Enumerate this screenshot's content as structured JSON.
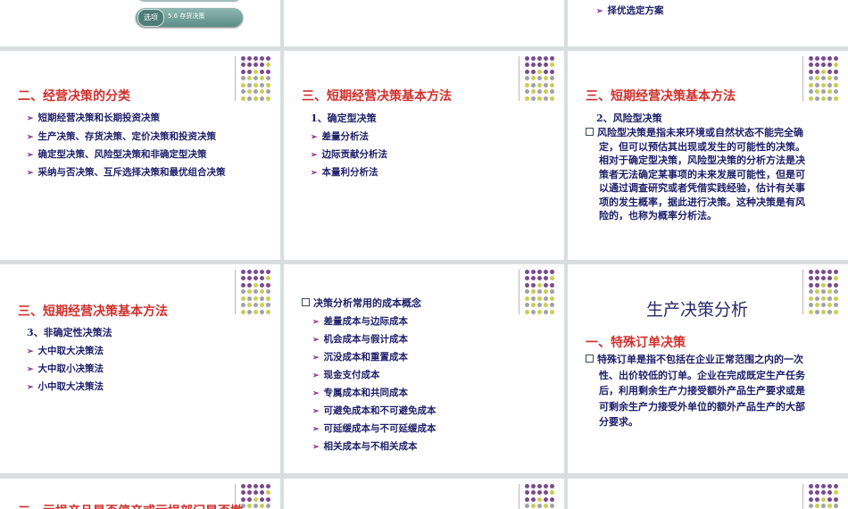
{
  "colors": {
    "title": "#d0312d",
    "body": "#1e1e6a",
    "arrow": "#8a2e8f",
    "dot_purple": "#7b4a8e",
    "dot_yellow": "#c8cf4e",
    "dot_gray": "#9fa3a8"
  },
  "row0": {
    "pill": {
      "icon_text": "选项",
      "label": "5.6 存货决策"
    },
    "right_bullet": "择优选定方案"
  },
  "slide_a": {
    "title": "二、经营决策的分类",
    "bullets": [
      "短期经营决策和长期投资决策",
      "生产决策、存货决策、定价决策和投资决策",
      "确定型决策、风险型决策和非确定型决策",
      "采纳与否决策、互斥选择决策和最优组合决策"
    ]
  },
  "slide_b": {
    "title": "三、短期经营决策基本方法",
    "subtitle": "1、确定型决策",
    "bullets": [
      "差量分析法",
      "边际贡献分析法",
      "本量利分析法"
    ]
  },
  "slide_c": {
    "title": "三、短期经营决策基本方法",
    "subtitle": "2、风险型决策",
    "lines": [
      "风险型决策是指未来环境或自然状态不能完全确",
      "定，但可以预估其出现或发生的可能性的决策。",
      "相对于确定型决策，风险型决策的分析方法是决",
      "策者无法确定某事项的未来发展可能性，但是可",
      "以通过调查研究或者凭借实践经验，估计有关事",
      "项的发生概率，据此进行决策。这种决策是有风",
      "险的，也称为概率分析法。"
    ]
  },
  "slide_d": {
    "title": "三、短期经营决策基本方法",
    "subtitle": "3、非确定性决策法",
    "bullets": [
      "大中取大决策法",
      "大中取小决策法",
      "小中取大决策法"
    ]
  },
  "slide_e": {
    "heading": "决策分析常用的成本概念",
    "bullets": [
      "差量成本与边际成本",
      "机会成本与假计成本",
      "沉没成本和重置成本",
      "现金支付成本",
      "专属成本和共同成本",
      "可避免成本和不可避免成本",
      "可延缓成本与不可延缓成本",
      "相关成本与不相关成本"
    ]
  },
  "slide_f": {
    "big_title": "生产决策分析",
    "title": "一、特殊订单决策",
    "lines": [
      "特殊订单是指不包括在企业正常范围之内的一次",
      "性、出价较低的订单。企业在完成既定生产任务",
      "后，利用剩余生产力接受额外产品生产要求或是",
      "可剩余生产力接受外单位的额外产品生产的大部",
      "分要求。"
    ]
  },
  "row3": {
    "title": "二、亏损产品是否停产或亏损部门是否撤"
  }
}
